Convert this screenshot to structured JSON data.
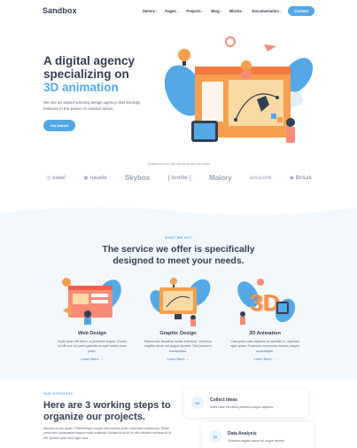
{
  "brand": {
    "name": "Sandbox",
    "accent": "#54a8e6",
    "orange": "#f78b77",
    "dark": "#343f52"
  },
  "nav": {
    "items": [
      "Demos",
      "Pages",
      "Projects",
      "Blog",
      "Blocks",
      "Documentation"
    ],
    "contact_label": "Contact"
  },
  "hero": {
    "title_line1": "A digital agency",
    "title_line2": "specializing on",
    "title_accent": "3D animation",
    "lead": "We are an award-winning design agency that strongly believes in the power of creative ideas.",
    "button_label": "Get Started"
  },
  "clients": {
    "caption": "Trusted by over 300 clients across the world",
    "logos": [
      "ezeel",
      "nauele",
      "Skybox",
      "brollie",
      "Malory",
      "area.link",
      "Brisak"
    ]
  },
  "services": {
    "eyebrow": "What We Do?",
    "title_line1": "The service we offer is specifically",
    "title_line2": "designed to meet your needs.",
    "cards": [
      {
        "title": "Web Design",
        "text": "Nulla vitae elit libero, a pharetra augue. Donec id elit non mi porta gravida at eget metus cras justo.",
        "link": "Learn More →"
      },
      {
        "title": "Graphic Design",
        "text": "Maecenas faucibus mollis interdum. Vivamus sagittis lacus vel augue laoreet. Sed posuere consectetur.",
        "link": "Learn More →"
      },
      {
        "title": "3D Animation",
        "text": "Cras justo odio dapibus ac facilisis in, egestas eget quam. Praesent commodo cursus magna scelerisque.",
        "link": "Learn More →"
      }
    ]
  },
  "strategy": {
    "eyebrow": "Our Strategy",
    "title_line1": "Here are 3 working steps to",
    "title_line2": "organize our projects.",
    "text": "Aenean eu leo quam. Pellentesque ornare sem lacinia quam venenatis vestibulum. Etiam porta sem malesuada magna mollis euismod. Nullam id dolor id nibh ultricies vehicula ut id elit. Nullam quis risus eget urna.",
    "steps": [
      {
        "num": "01",
        "title": "Collect Ideas",
        "text": "Nulla vitae elit libero pharetra augue dapibus."
      },
      {
        "num": "02",
        "title": "Data Analysis",
        "text": "Vivamus sagittis lacus vel augue laoreet."
      }
    ]
  }
}
